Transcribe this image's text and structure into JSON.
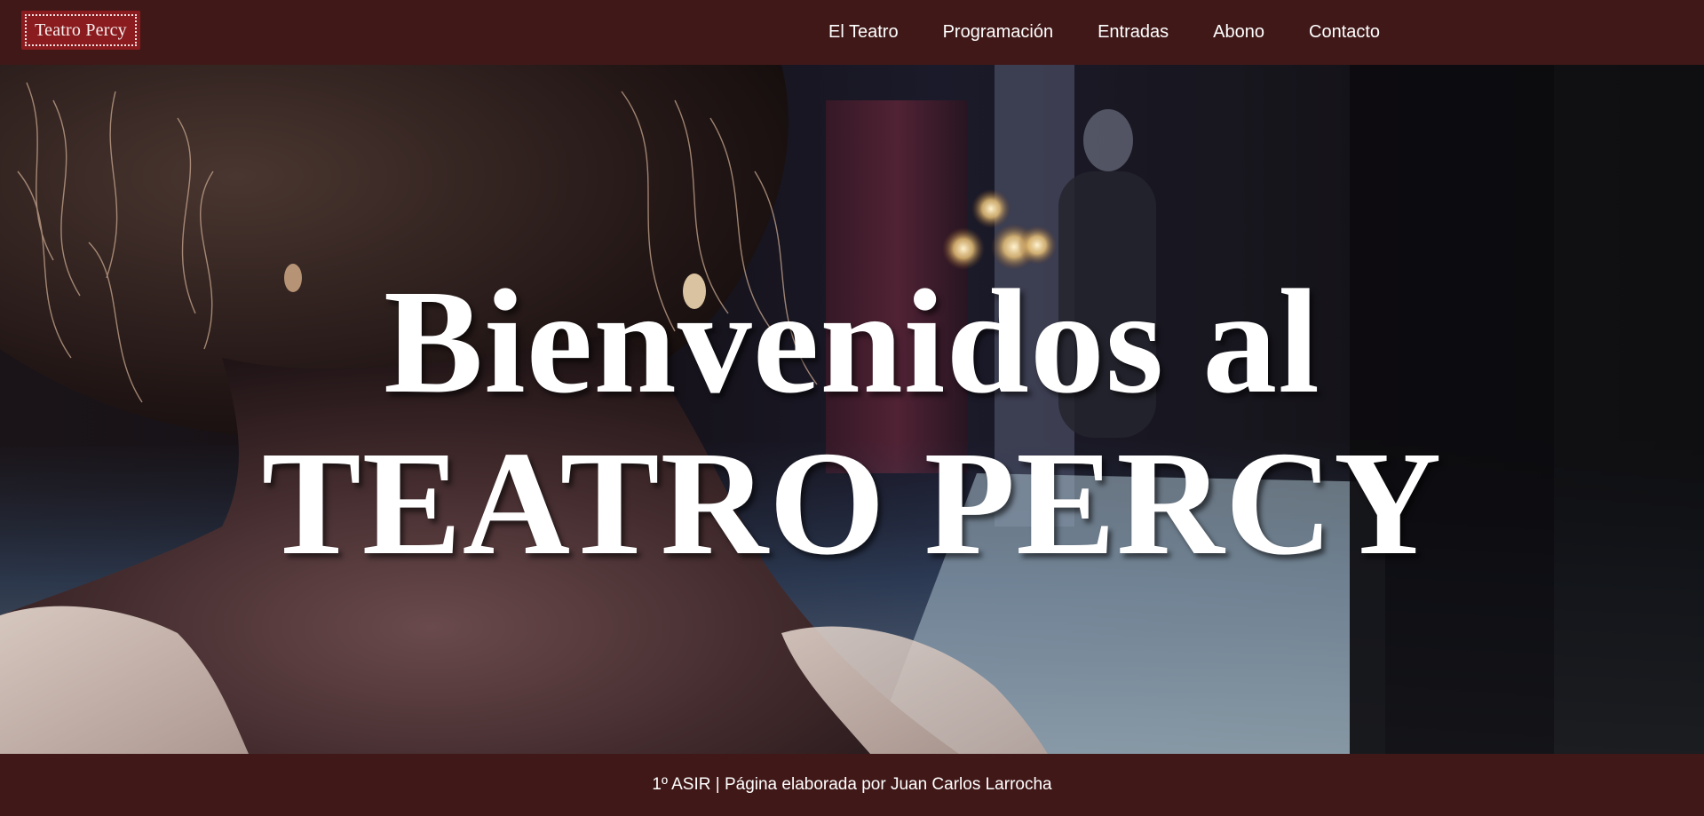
{
  "header": {
    "logo_text": "Teatro Percy",
    "nav": [
      {
        "label": "El Teatro"
      },
      {
        "label": "Programación"
      },
      {
        "label": "Entradas"
      },
      {
        "label": "Abono"
      },
      {
        "label": "Contacto"
      }
    ]
  },
  "hero": {
    "title_line_1": "Bienvenidos al",
    "title_line_2": "TEATRO PERCY",
    "image_description_icon": "theater-backstage-photo"
  },
  "footer": {
    "text": "1º ASIR | Página elaborada por Juan Carlos Larrocha"
  },
  "colors": {
    "header_bg": "#411818",
    "footer_bg": "#411818",
    "logo_bg": "#8a1c1f",
    "text": "#ffffff"
  }
}
